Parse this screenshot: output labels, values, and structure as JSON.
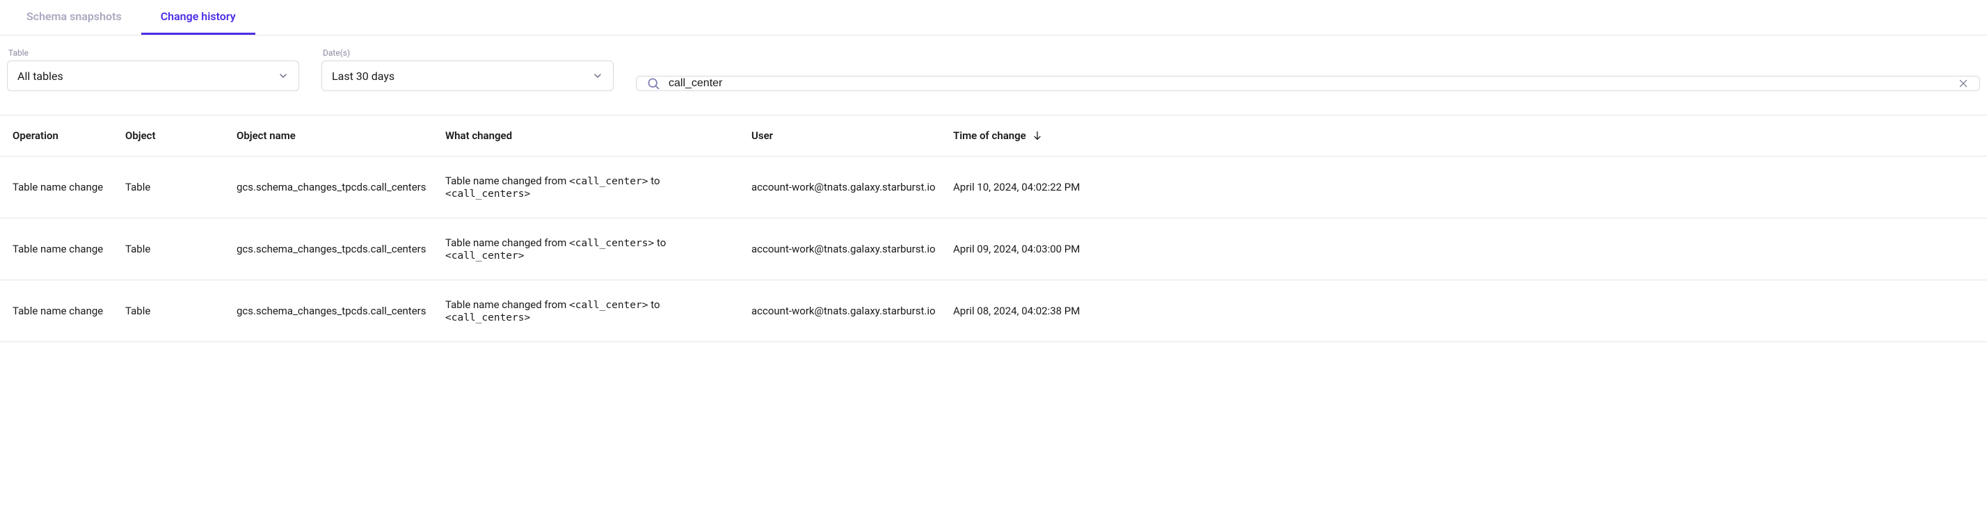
{
  "tabs": {
    "schema_snapshots": "Schema snapshots",
    "change_history": "Change history"
  },
  "filters": {
    "table_label": "Table",
    "table_value": "All tables",
    "dates_label": "Date(s)",
    "dates_value": "Last 30 days",
    "search_value": "call_center"
  },
  "columns": {
    "operation": "Operation",
    "object": "Object",
    "object_name": "Object name",
    "what_changed": "What changed",
    "user": "User",
    "time_of_change": "Time of change"
  },
  "rows": [
    {
      "operation": "Table name change",
      "object": "Table",
      "object_name": "gcs.schema_changes_tpcds.call_centers",
      "changed_prefix": "Table name changed from ",
      "changed_from": "<call_center>",
      "changed_mid": " to ",
      "changed_to": "<call_centers>",
      "user": "account-work@tnats.galaxy.starburst.io",
      "time": "April 10, 2024, 04:02:22 PM"
    },
    {
      "operation": "Table name change",
      "object": "Table",
      "object_name": "gcs.schema_changes_tpcds.call_centers",
      "changed_prefix": "Table name changed from ",
      "changed_from": "<call_centers>",
      "changed_mid": " to ",
      "changed_to": "<call_center>",
      "user": "account-work@tnats.galaxy.starburst.io",
      "time": "April 09, 2024, 04:03:00 PM"
    },
    {
      "operation": "Table name change",
      "object": "Table",
      "object_name": "gcs.schema_changes_tpcds.call_centers",
      "changed_prefix": "Table name changed from ",
      "changed_from": "<call_center>",
      "changed_mid": " to ",
      "changed_to": "<call_centers>",
      "user": "account-work@tnats.galaxy.starburst.io",
      "time": "April 08, 2024, 04:02:38 PM"
    }
  ]
}
